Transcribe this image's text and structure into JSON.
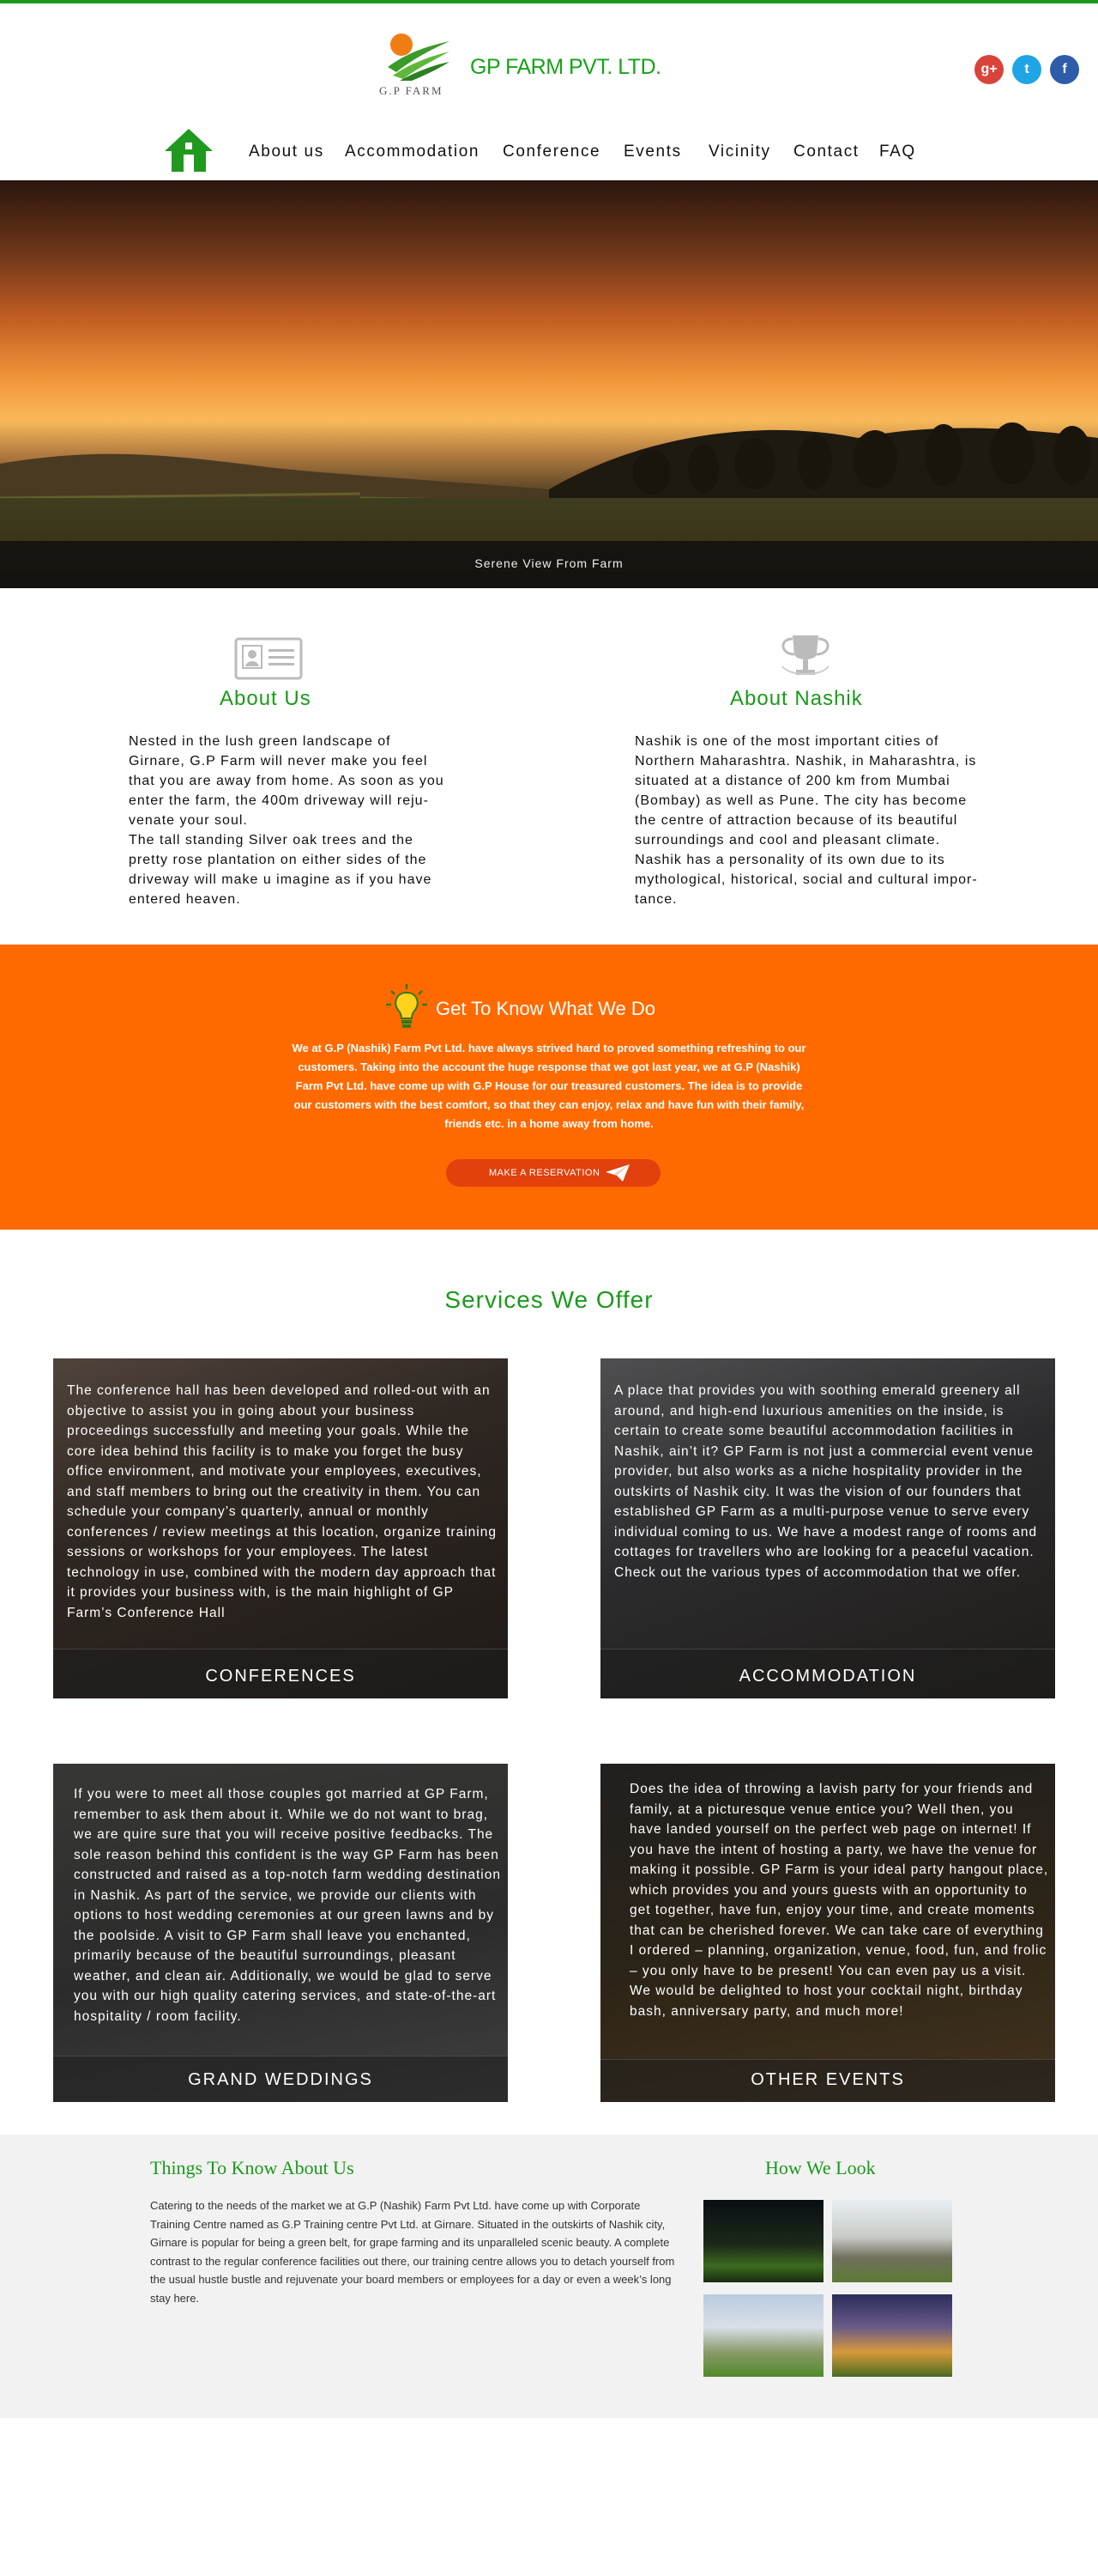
{
  "header": {
    "logo_subtext": "G.P   FARM",
    "brand": "GP FARM PVT. LTD.",
    "social": [
      {
        "name": "google-plus",
        "glyph": "g+",
        "color": "#d9443a"
      },
      {
        "name": "twitter",
        "glyph": "t",
        "color": "#1fa4e6"
      },
      {
        "name": "facebook",
        "glyph": "f",
        "color": "#2d5ca8"
      }
    ]
  },
  "nav": {
    "home_icon": "home-icon",
    "items": [
      "About us",
      "Accommodation",
      "Conference",
      "Events",
      "Vicinity",
      "Contact",
      "FAQ"
    ]
  },
  "hero": {
    "caption": "Serene View From Farm"
  },
  "about": {
    "us_title": "About Us",
    "us_text": "Nested in the lush green landscape of\nGirnare, G.P Farm will never make you feel\nthat you are away from home. As soon as you\nenter the farm, the 400m driveway will reju-\nvenate your soul.\nThe tall standing Silver oak trees and the\npretty rose plantation on either sides of the\ndriveway will make u imagine as if you have\nentered heaven.",
    "nashik_title": "About Nashik",
    "nashik_text": "Nashik is one of the most important cities of\nNorthern Maharashtra. Nashik, in Maharashtra, is\nsituated at a distance of 200 km from Mumbai\n(Bombay) as well as Pune. The city has become\nthe centre of attraction because of its beautiful\nsurroundings and cool and pleasant climate.\nNashik has a personality of its own due to its\nmythological, historical, social and cultural impor-\ntance."
  },
  "what_we_do": {
    "title": "Get To Know What We Do",
    "text": "We at G.P (Nashik) Farm Pvt Ltd. have always strived hard to proved something refreshing to our customers. Taking into the account the huge response that we got last year, we at G.P (Nashik) Farm Pvt Ltd. have come up with G.P House for our treasured customers. The idea is to provide our customers with the best comfort, so that they can enjoy, relax and have fun with their family, friends etc. in a home away from home.",
    "button": "MAKE A RESERVATION"
  },
  "services": {
    "title": "Services We Offer",
    "cards": [
      {
        "label": "CONFERENCES",
        "text": "The conference hall has been developed and rolled-out with an objective to assist you in going about your business proceedings successfully and meeting your goals. While the core idea behind this facility is to make you forget the busy office environment, and motivate your employees, executives, and staff members to bring out the creativity in them. You can schedule your company’s quarterly, annual or monthly conferences / review meetings at this location, organize training sessions or workshops for your employees. The latest technology in use, combined with the modern day approach that it provides your business with, is the main highlight of GP Farm’s Conference Hall"
      },
      {
        "label": "ACCOMMODATION",
        "text": "A place that provides you with soothing emerald greenery all around, and high-end luxurious amenities on the inside, is certain to create some beautiful accommodation facilities in Nashik, ain’t it? GP Farm is not just a commercial event venue provider, but also works as a niche hospitality provider in the outskirts of Nashik city. It was the vision of our founders that established GP Farm as a multi-purpose venue to serve every individual coming to us. We have a modest range of rooms and cottages for travellers who are looking for a peaceful vacation. Check out the various types of accommodation that we offer."
      },
      {
        "label": "GRAND WEDDINGS",
        "text": "If you were to meet all those couples got married at GP Farm, remember to ask them about it. While we do not want to brag, we are quire sure that you will receive positive feedbacks. The sole reason behind this confident is the way GP Farm has been constructed and raised as a top-notch farm wedding destination in Nashik. As part of the service, we provide our clients with options to host wedding ceremonies at our green lawns and by the poolside. A visit to GP Farm shall leave you enchanted, primarily because of the beautiful surroundings, pleasant weather, and clean air. Additionally, we would be glad to serve you with our high quality catering services, and state-of-the-art hospitality / room facility."
      },
      {
        "label": "OTHER EVENTS",
        "text": "Does the idea of throwing a lavish party for your friends and family, at a picturesque venue entice you? Well then, you have landed yourself on the perfect web page on internet! If you have the intent of hosting a party, we have the venue for making it possible. GP Farm is your ideal party hangout place, which provides you and yours guests with an opportunity to get together, have fun, enjoy your time, and create moments that can be cherished forever. We can take care of everything I ordered – planning, organization, venue, food, fun, and frolic – you only have to be present! You can even pay us a visit. We would be delighted to host your cocktail night, birthday bash, anniversary party, and much more!"
      }
    ]
  },
  "footer": {
    "things_title": "Things To Know About Us",
    "things_text": "Catering to the needs of the market we at G.P (Nashik) Farm Pvt Ltd. have come up with Corporate Training Centre named as G.P Training centre Pvt Ltd. at Girnare. Situated in the outskirts of Nashik city, Girnare is popular for being a green belt, for grape farming and its unparalleled scenic beauty. A complete contrast to the regular conference facilities out there, our training centre allows you to detach yourself from the usual hustle bustle and rejuvenate your board members or employees for a day or even a week’s long stay here.",
    "look_title": "How We Look"
  },
  "colors": {
    "brand_green": "#1a9a1a",
    "orange": "#ff6a00",
    "button_red": "#e2400c"
  }
}
